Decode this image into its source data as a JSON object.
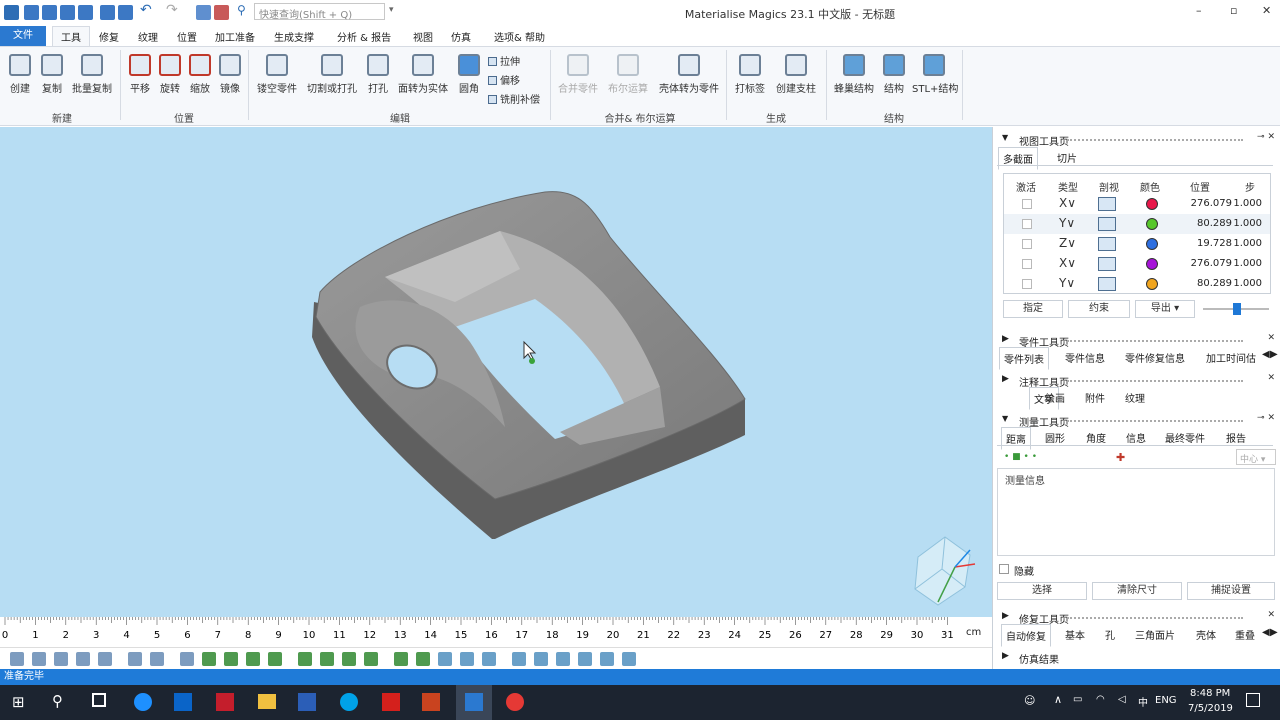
{
  "titlebar": {
    "search_placeholder": "快速查询(Shift + Q)",
    "app_title": "Materialise Magics 23.1 中文版 - 无标题"
  },
  "tabs": [
    {
      "label": "文件"
    },
    {
      "label": "工具"
    },
    {
      "label": "修复"
    },
    {
      "label": "纹理"
    },
    {
      "label": "位置"
    },
    {
      "label": "加工准备"
    },
    {
      "label": "生成支撑"
    },
    {
      "label": "分析 & 报告"
    },
    {
      "label": "视图"
    },
    {
      "label": "仿真"
    },
    {
      "label": "选项& 帮助"
    }
  ],
  "ribbon": {
    "new": {
      "create": "创建",
      "copy": "复制",
      "batch_copy": "批量复制",
      "group": "新建"
    },
    "position": {
      "translate": "平移",
      "rotate": "旋转",
      "scale": "缩放",
      "mirror": "镜像",
      "group": "位置"
    },
    "edit": {
      "hollow": "镂空零件",
      "cut": "切割或打孔",
      "punch": "打孔",
      "face_to_solid": "面转为实体",
      "fillet": "圆角",
      "extrude": "拉伸",
      "offset": "偏移",
      "mill_comp": "铣削补偿",
      "group": "编辑"
    },
    "boolean": {
      "merge": "合并零件",
      "boolean_op": "布尔运算",
      "shell_to_part": "壳体转为零件",
      "group": "合并& 布尔运算"
    },
    "generate": {
      "label_tool": "打标签",
      "create_pillar": "创建支柱",
      "group": "生成"
    },
    "structure": {
      "honeycomb": "蜂巢结构",
      "structure": "结构",
      "stl_structure": "STL+结构",
      "group": "结构"
    }
  },
  "ruler": {
    "ticks": [
      "0",
      "1",
      "2",
      "3",
      "4",
      "5",
      "6",
      "7",
      "8",
      "9",
      "10",
      "11",
      "12",
      "13",
      "14",
      "15",
      "16",
      "17",
      "18",
      "19",
      "20",
      "21",
      "22",
      "23",
      "24",
      "25",
      "26",
      "27",
      "28",
      "29",
      "30",
      "31"
    ],
    "unit": "cm"
  },
  "status": {
    "text": "准备完毕"
  },
  "view_panel": {
    "title": "视图工具页",
    "tabs": [
      "多截面",
      "切片"
    ],
    "headers": {
      "active": "激活",
      "type": "类型",
      "section": "剖视",
      "color": "颜色",
      "position": "位置",
      "step": "步"
    },
    "rows": [
      {
        "axis": "X∨",
        "color": "#e8184a",
        "position": "276.079",
        "step": "1.000"
      },
      {
        "axis": "Y∨",
        "color": "#57c72b",
        "position": "80.289",
        "step": "1.000"
      },
      {
        "axis": "Z∨",
        "color": "#2e6fe0",
        "position": "19.728",
        "step": "1.000"
      },
      {
        "axis": "X∨",
        "color": "#a614d8",
        "position": "276.079",
        "step": "1.000"
      },
      {
        "axis": "Y∨",
        "color": "#f0a51f",
        "position": "80.289",
        "step": "1.000"
      }
    ],
    "buttons": {
      "assign": "指定",
      "constrain": "约束",
      "export": "导出"
    },
    "slider_fraction": 0.52
  },
  "part_panel": {
    "title": "零件工具页",
    "tabs": [
      "零件列表",
      "零件信息",
      "零件修复信息",
      "加工时间估"
    ]
  },
  "annotation_panel": {
    "title": "注释工具页",
    "tabs": [
      "文字",
      "绘画",
      "附件",
      "纹理"
    ]
  },
  "measure_panel": {
    "title": "测量工具页",
    "tabs": [
      "距离",
      "圆形",
      "角度",
      "信息",
      "最终零件",
      "报告"
    ],
    "dropdown": "中心",
    "info_label": "测量信息",
    "hide_label": "隐藏",
    "buttons": {
      "select": "选择",
      "clear": "清除尺寸",
      "snap": "捕捉设置"
    }
  },
  "fix_panel": {
    "title": "修复工具页",
    "tabs": [
      "自动修复",
      "基本",
      "孔",
      "三角面片",
      "壳体",
      "重叠"
    ]
  },
  "sim_panel": {
    "title": "仿真结果"
  },
  "taskbar": {
    "lang": "ENG",
    "time": "8:48 PM",
    "date": "7/5/2019"
  }
}
